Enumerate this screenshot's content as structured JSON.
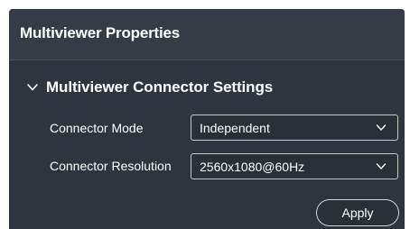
{
  "panel": {
    "title": "Multiviewer Properties"
  },
  "section": {
    "title": "Multiviewer Connector Settings",
    "expanded": true,
    "icon": "chevron-down-icon"
  },
  "fields": [
    {
      "label": "Connector Mode",
      "value": "Independent"
    },
    {
      "label": "Connector Resolution",
      "value": "2560x1080@60Hz"
    }
  ],
  "actions": {
    "apply_label": "Apply"
  },
  "colors": {
    "panel_background": "#2f353f",
    "header_background": "#363c46",
    "text": "#ffffff",
    "control_border": "#c8c8c8"
  }
}
